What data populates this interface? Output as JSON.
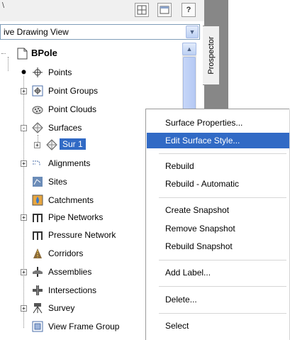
{
  "toolbar": {
    "title_fragment": "\\",
    "help_label": "?"
  },
  "view_dropdown": {
    "value": "ive Drawing View"
  },
  "prospector_tab": {
    "label": "Prospector"
  },
  "tree": {
    "root": "BPole",
    "items": [
      {
        "label": "Points",
        "icon": "points-icon",
        "expander": "none"
      },
      {
        "label": "Point Groups",
        "icon": "point-groups-icon",
        "expander": "+"
      },
      {
        "label": "Point Clouds",
        "icon": "point-clouds-icon",
        "expander": "none"
      },
      {
        "label": "Surfaces",
        "icon": "surfaces-icon",
        "expander": "-"
      },
      {
        "label": "Sur 1",
        "icon": "surface-icon",
        "expander": "+"
      },
      {
        "label": "Alignments",
        "icon": "alignments-icon",
        "expander": "+"
      },
      {
        "label": "Sites",
        "icon": "sites-icon",
        "expander": "none"
      },
      {
        "label": "Catchments",
        "icon": "catchments-icon",
        "expander": "none"
      },
      {
        "label": "Pipe Networks",
        "icon": "pipe-networks-icon",
        "expander": "+"
      },
      {
        "label": "Pressure Network",
        "icon": "pressure-network-icon",
        "expander": "none"
      },
      {
        "label": "Corridors",
        "icon": "corridors-icon",
        "expander": "none"
      },
      {
        "label": "Assemblies",
        "icon": "assemblies-icon",
        "expander": "+"
      },
      {
        "label": "Intersections",
        "icon": "intersections-icon",
        "expander": "none"
      },
      {
        "label": "Survey",
        "icon": "survey-icon",
        "expander": "+"
      },
      {
        "label": "View Frame Group",
        "icon": "view-frame-group-icon",
        "expander": "none"
      }
    ]
  },
  "context_menu": {
    "items": [
      {
        "label": "Surface Properties...",
        "highlighted": false
      },
      {
        "label": "Edit Surface Style...",
        "highlighted": true
      },
      {
        "label": "Rebuild",
        "highlighted": false
      },
      {
        "label": "Rebuild - Automatic",
        "highlighted": false
      },
      {
        "label": "Create Snapshot",
        "highlighted": false
      },
      {
        "label": "Remove Snapshot",
        "highlighted": false
      },
      {
        "label": "Rebuild Snapshot",
        "highlighted": false
      },
      {
        "label": "Add Label...",
        "highlighted": false
      },
      {
        "label": "Delete...",
        "highlighted": false
      },
      {
        "label": "Select",
        "highlighted": false
      }
    ]
  },
  "colors": {
    "selection": "#316ac5",
    "panel_dark": "#878787",
    "toolbar": "#f0f0f0"
  }
}
